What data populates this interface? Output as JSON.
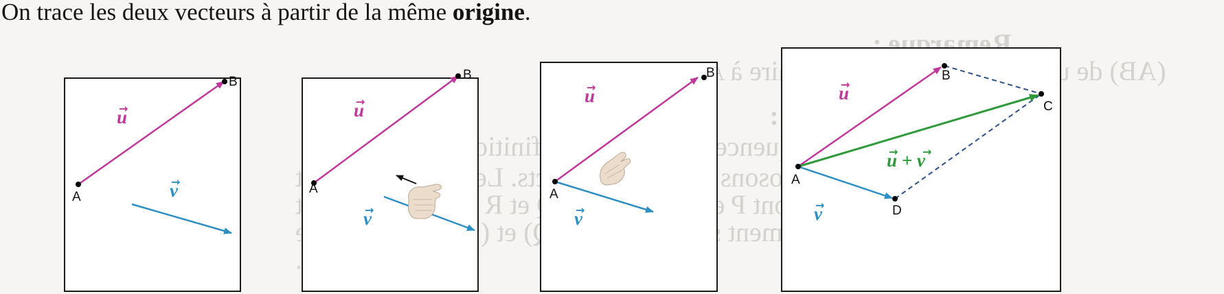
{
  "headline": {
    "text_before": "On trace les deux vecteurs à partir de la même ",
    "text_bold": "origine",
    "text_after": "."
  },
  "colors": {
    "u": "#c0379b",
    "v": "#2e8fc4",
    "sum": "#2f9a3a",
    "dashed": "#2a4f8a",
    "point": "#000000"
  },
  "labels": {
    "A": "A",
    "B": "B",
    "C": "C",
    "D": "D",
    "u": "u",
    "v": "v",
    "sum": "u + v",
    "arrow": "→"
  },
  "icons": [
    "hand-icon",
    "pointer-arrow-icon"
  ]
}
